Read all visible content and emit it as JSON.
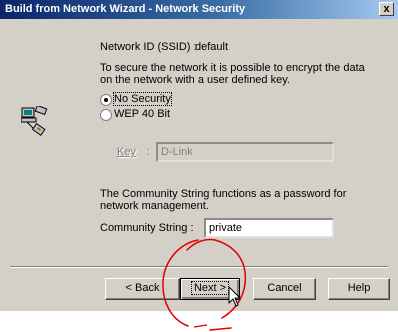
{
  "window": {
    "title": "Build from Network Wizard - Network Security",
    "close_label": "x"
  },
  "ssid": {
    "label": "Network ID (SSID) :",
    "value": "default"
  },
  "intro_line1": "To secure the network it is possible to encrypt the data",
  "intro_line2": "on the network with a user defined key.",
  "security": {
    "options": [
      {
        "label": "No Security",
        "selected": true
      },
      {
        "label": "WEP 40 Bit",
        "selected": false
      }
    ]
  },
  "key": {
    "label": "Key",
    "separator": ":",
    "value": "D-Link"
  },
  "community": {
    "info_line1": "The Community String functions as a password for",
    "info_line2": "network management.",
    "label": "Community String :",
    "value": "private"
  },
  "buttons": {
    "back": "< Back",
    "next": "Next >",
    "cancel": "Cancel",
    "help": "Help"
  },
  "colors": {
    "title_gradient_start": "#0a246a",
    "title_gradient_end": "#a6caf0",
    "dialog_face": "#d4d0c8",
    "annotation_circle": "#e00000"
  },
  "icons": {
    "network": "network-computer-icon",
    "cursor": "mouse-pointer-icon"
  }
}
